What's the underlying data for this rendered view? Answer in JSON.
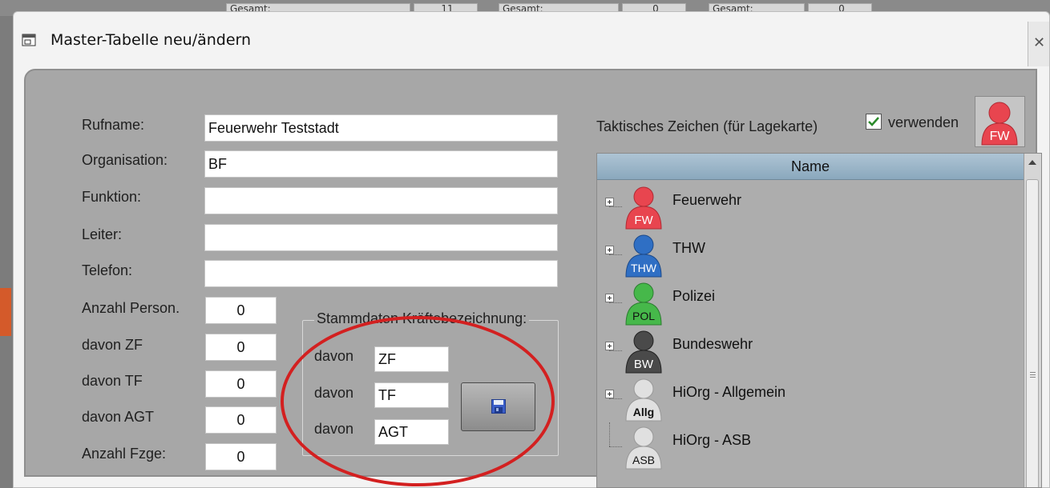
{
  "background": {
    "cells": [
      "Gesamt:",
      "11",
      "Gesamt:",
      "0",
      "Gesamt:",
      "0"
    ]
  },
  "dialog": {
    "title": "Master-Tabelle neu/ändern"
  },
  "form": {
    "rufname": {
      "label": "Rufname:",
      "value": "Feuerwehr Teststadt"
    },
    "organisation": {
      "label": "Organisation:",
      "value": "BF"
    },
    "funktion": {
      "label": "Funktion:",
      "value": ""
    },
    "leiter": {
      "label": "Leiter:",
      "value": ""
    },
    "telefon": {
      "label": "Telefon:",
      "value": ""
    },
    "anzahl_person": {
      "label": "Anzahl Person.",
      "value": "0"
    },
    "davon_zf": {
      "label": "davon ZF",
      "value": "0"
    },
    "davon_tf": {
      "label": "davon TF",
      "value": "0"
    },
    "davon_agt": {
      "label": "davon AGT",
      "value": "0"
    },
    "anzahl_fzge": {
      "label": "Anzahl Fzge:",
      "value": "0"
    }
  },
  "stammdaten": {
    "legend": "Stammdaten Kräftebezeichnung:",
    "rows": [
      {
        "label": "davon",
        "value": "ZF"
      },
      {
        "label": "davon",
        "value": "TF"
      },
      {
        "label": "davon",
        "value": "AGT"
      }
    ]
  },
  "tactical": {
    "label": "Taktisches Zeichen (für Lagekarte)",
    "checkbox_label": "verwenden",
    "checked": true,
    "preview_text": "FW",
    "preview_color": "#e8454f"
  },
  "tree": {
    "header": "Name",
    "items": [
      {
        "label": "Feuerwehr",
        "icon_text": "FW",
        "color": "#e8454f",
        "expandable": true
      },
      {
        "label": "THW",
        "icon_text": "THW",
        "color": "#2f6fc4",
        "expandable": true
      },
      {
        "label": "Polizei",
        "icon_text": "POL",
        "color": "#46b84a",
        "expandable": true
      },
      {
        "label": "Bundeswehr",
        "icon_text": "BW",
        "color": "#4a4a4a",
        "expandable": true
      },
      {
        "label": "HiOrg - Allgemein",
        "icon_text": "Allg",
        "color": "#e0e0e0",
        "expandable": true
      },
      {
        "label": "HiOrg - ASB",
        "icon_text": "ASB",
        "color": "#e0e0e0",
        "expandable": false
      }
    ]
  },
  "annotation": {
    "color": "#d32020"
  }
}
